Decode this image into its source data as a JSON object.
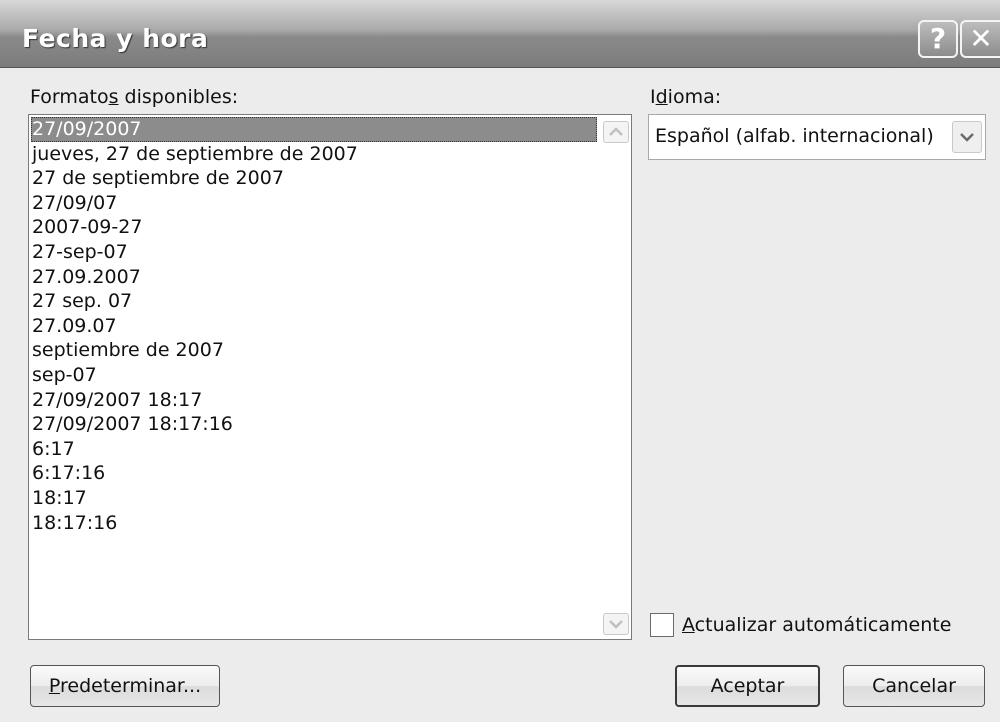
{
  "window": {
    "title": "Fecha y hora",
    "help_glyph": "?",
    "close_glyph": "✕"
  },
  "formats": {
    "label_pre": "Formato",
    "label_access": "s",
    "label_post": " disponibles:",
    "items": [
      "27/09/2007",
      "jueves, 27 de septiembre de 2007",
      "27 de septiembre de 2007",
      "27/09/07",
      "2007-09-27",
      "27-sep-07",
      "27.09.2007",
      "27 sep. 07",
      "27.09.07",
      "septiembre de 2007",
      "sep-07",
      "27/09/2007 18:17",
      "27/09/2007 18:17:16",
      "6:17",
      "6:17:16",
      "18:17",
      "18:17:16"
    ],
    "selected_index": 0
  },
  "language": {
    "label_pre": "I",
    "label_access": "d",
    "label_post": "ioma:",
    "value": "Español (alfab. internacional)"
  },
  "auto_update": {
    "label_access": "A",
    "label_post": "ctualizar automáticamente",
    "checked": false
  },
  "buttons": {
    "default_access": "P",
    "default_post": "redeterminar...",
    "ok": "Aceptar",
    "cancel": "Cancelar"
  },
  "icons": {
    "help": "help-icon",
    "close": "close-icon",
    "scroll_up": "chevron-up-icon",
    "scroll_down": "chevron-down-icon",
    "dropdown": "chevron-down-icon"
  }
}
